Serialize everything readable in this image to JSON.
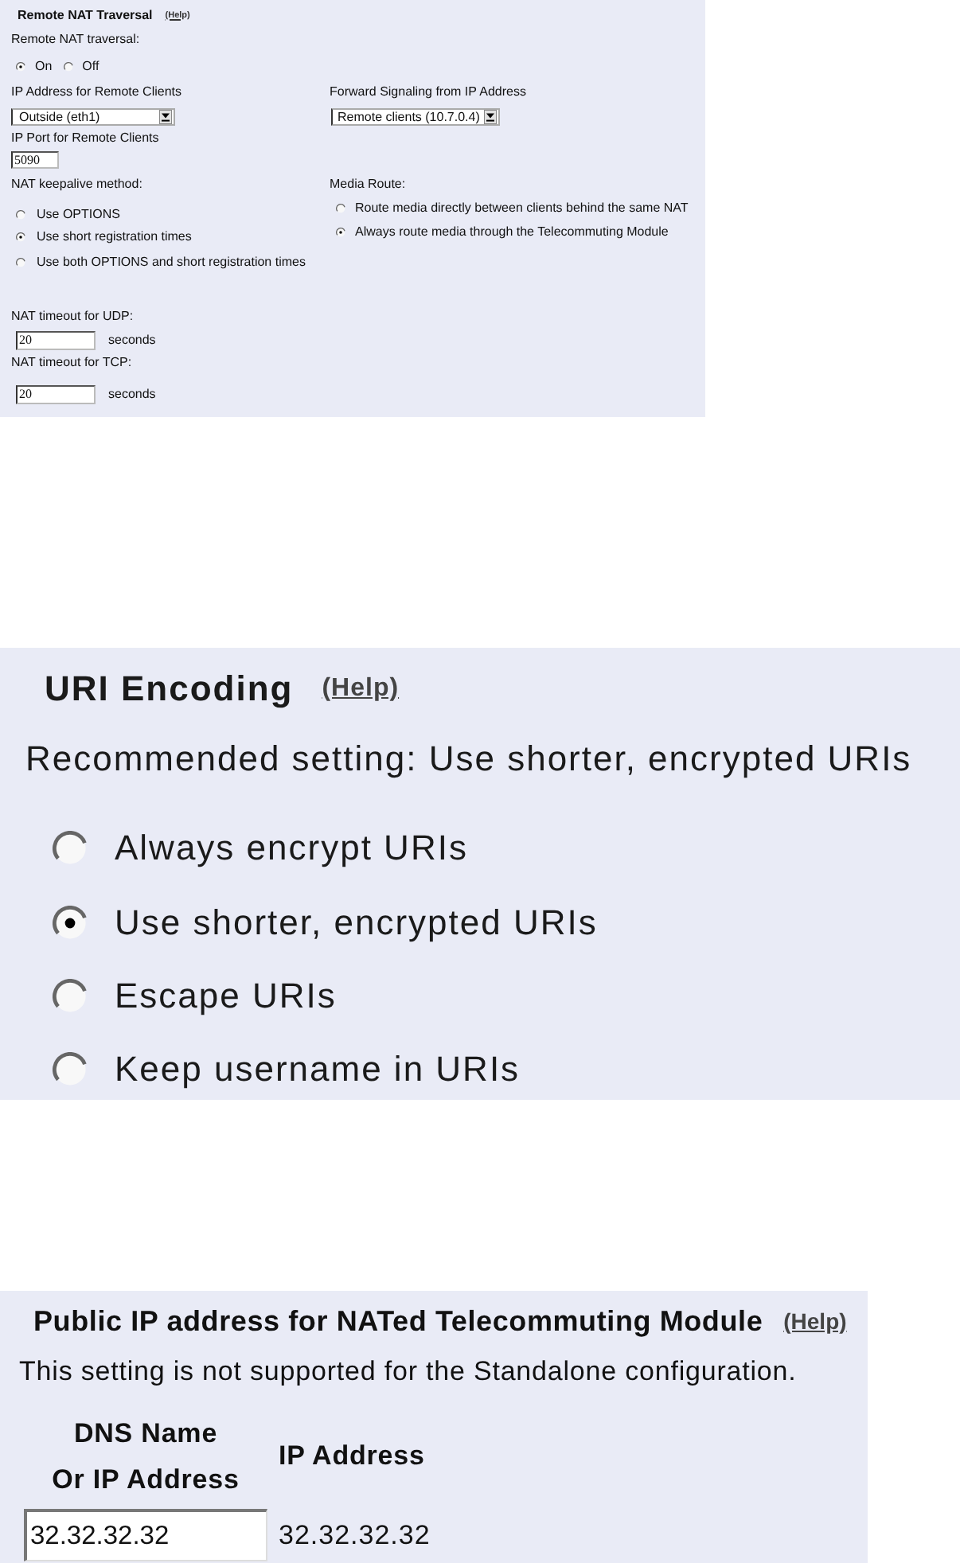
{
  "nat_traversal_panel": {
    "title": "Remote NAT Traversal",
    "help_link": "(Help)",
    "remote_nat_traversal": {
      "label": "Remote NAT traversal:",
      "options": [
        {
          "label": "On",
          "selected": true
        },
        {
          "label": "Off",
          "selected": false
        }
      ]
    },
    "ip_address_for_remote_clients": {
      "label": "IP Address for Remote Clients",
      "value": "Outside (eth1)"
    },
    "forward_signaling": {
      "label": "Forward Signaling from IP Address",
      "value": "Remote clients (10.7.0.4)"
    },
    "ip_port_for_remote_clients": {
      "label": "IP Port for Remote Clients",
      "value": "5090"
    },
    "keepalive_method": {
      "label": "NAT keepalive method:",
      "options": [
        {
          "label": "Use OPTIONS",
          "selected": false
        },
        {
          "label": "Use short registration times",
          "selected": true
        },
        {
          "label": "Use both OPTIONS and short registration times",
          "selected": false
        }
      ]
    },
    "media_route": {
      "label": "Media Route:",
      "options": [
        {
          "label": "Route media directly between clients behind the same NAT",
          "selected": false
        },
        {
          "label": "Always route media through the Telecommuting Module",
          "selected": true
        }
      ]
    },
    "udp_timeout": {
      "label": "NAT timeout for UDP:",
      "value": "20",
      "unit": "seconds"
    },
    "tcp_timeout": {
      "label": "NAT timeout for TCP:",
      "value": "20",
      "unit": "seconds"
    }
  },
  "uri_encoding_panel": {
    "title": "URI Encoding",
    "help_link": "(Help)",
    "recommendation": "Recommended setting: Use shorter, encrypted URIs",
    "options": [
      {
        "label": "Always encrypt URIs",
        "selected": false
      },
      {
        "label": "Use shorter, encrypted URIs",
        "selected": true
      },
      {
        "label": "Escape URIs",
        "selected": false
      },
      {
        "label": "Keep username in URIs",
        "selected": false
      }
    ]
  },
  "public_ip_panel": {
    "title": "Public IP address for NATed Telecommuting Module",
    "help_link": "(Help)",
    "note": "This setting is not supported for the Standalone configuration.",
    "table": {
      "columns": [
        "DNS Name\nOr IP Address",
        "IP Address"
      ],
      "rows": [
        {
          "dns_name_or_ip_address": "32.32.32.32",
          "ip_address": "32.32.32.32"
        }
      ]
    }
  }
}
